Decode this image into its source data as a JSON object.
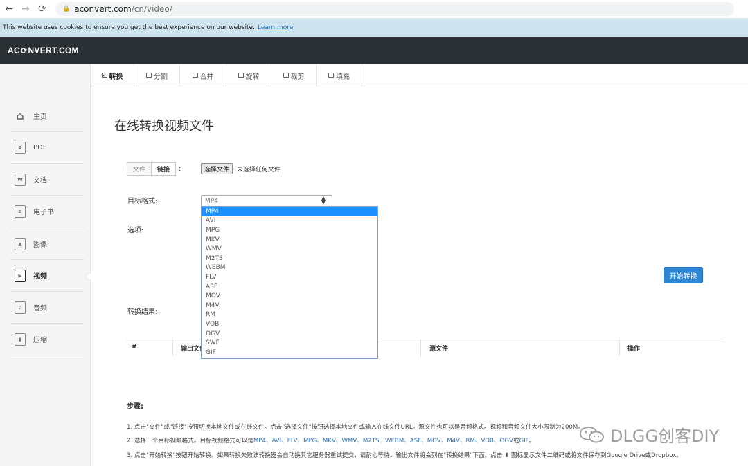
{
  "browser": {
    "url_host": "aconvert.com",
    "url_path": "/cn/video/"
  },
  "cookie": {
    "text": "This website uses cookies to ensure you get the best experience on our website.",
    "learn_more": "Learn more"
  },
  "header": {
    "logo_left": "AC",
    "logo_right": "NVERT.COM"
  },
  "sidebar": {
    "items": [
      {
        "label": "主页",
        "icon": "home-icon"
      },
      {
        "label": "PDF",
        "icon": "pdf-icon"
      },
      {
        "label": "文档",
        "icon": "document-icon"
      },
      {
        "label": "电子书",
        "icon": "ebook-icon"
      },
      {
        "label": "图像",
        "icon": "image-icon"
      },
      {
        "label": "视频",
        "icon": "video-icon",
        "active": true
      },
      {
        "label": "音频",
        "icon": "audio-icon"
      },
      {
        "label": "压缩",
        "icon": "archive-icon"
      }
    ]
  },
  "tabs": [
    {
      "label": "转换",
      "active": true
    },
    {
      "label": "分割"
    },
    {
      "label": "合并"
    },
    {
      "label": "旋转"
    },
    {
      "label": "裁剪"
    },
    {
      "label": "填充"
    }
  ],
  "main": {
    "title": "在线转换视频文件",
    "source_file": "文件",
    "source_link": "链接",
    "colon": ":",
    "choose_file": "选择文件",
    "no_file": "未选择任何文件",
    "format_label": "目标格式:",
    "options_label": "选项:",
    "result_label": "转换结果:",
    "start_button": "开始转换",
    "selected_format": "MP4",
    "formats": [
      "MP4",
      "AVI",
      "MPG",
      "MKV",
      "WMV",
      "M2TS",
      "WEBM",
      "FLV",
      "ASF",
      "MOV",
      "M4V",
      "RM",
      "VOB",
      "OGV",
      "SWF",
      "GIF"
    ]
  },
  "table": {
    "headers": [
      "#",
      "输出文件",
      "源文件",
      "操作"
    ]
  },
  "steps": {
    "title": "步骤:",
    "step1": "1. 点击\"文件\"或\"链接\"按钮切换本地文件或在线文件。点击\"选择文件\"按钮选择本地文件或输入在线文件URL。源文件也可以是音频格式。视频和音频文件大小限制为200M。",
    "step2_prefix": "2. 选择一个目标视频格式。目标视频格式可以是",
    "step2_formats": "MP4、AVI、FLV、MPG、MKV、WMV、M2TS、WEBM、ASF、MOV、M4V、RM、VOB、OGV",
    "step2_or": "或",
    "step2_last": "GIF",
    "step2_end": "。",
    "step3": "3. 点击\"开始转换\"按钮开始转换。如果转换失败该转换器会自动换其它服务器重试提交，请耐心等待。输出文件将会列在\"转换结果\"下面。点击 ⬇ 图标显示文件二维码或将文件保存到Google Drive或Dropbox。"
  },
  "watermark": {
    "text": "DLGG创客DIY"
  }
}
